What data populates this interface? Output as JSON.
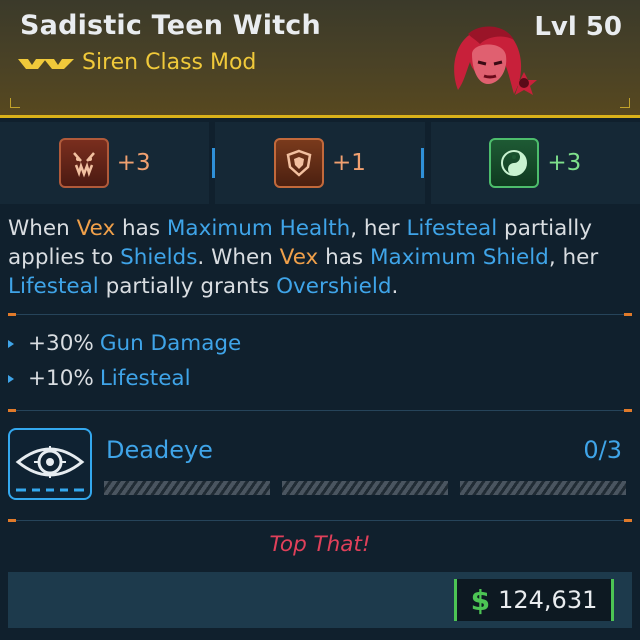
{
  "item": {
    "name": "Sadistic Teen Witch",
    "class_label": "Siren Class Mod",
    "level": "Lvl 50",
    "rarity_color": "#d9b21a"
  },
  "bonuses": [
    {
      "icon": "fangs-icon",
      "value": "+3",
      "color": "#f0a070"
    },
    {
      "icon": "shield-emblem-icon",
      "value": "+1",
      "color": "#f0a070"
    },
    {
      "icon": "yin-yang-gun-icon",
      "value": "+3",
      "color": "#7ee08b"
    }
  ],
  "description": {
    "p1": "When ",
    "vex1": "Vex",
    "p2": " has ",
    "max_health": "Maximum Health",
    "p3": ", her ",
    "lifesteal1": "Lifesteal",
    "p4": " partially applies to ",
    "shields": "Shields",
    "p5": ". When ",
    "vex2": "Vex",
    "p6": " has ",
    "max_shield": "Maximum Shield",
    "p7": ", her ",
    "lifesteal2": "Lifesteal",
    "p8": " partially grants ",
    "overshield": "Overshield",
    "p9": "."
  },
  "stats": [
    {
      "value": "+30%",
      "name": "Gun Damage"
    },
    {
      "value": "+10%",
      "name": "Lifesteal"
    }
  ],
  "skill": {
    "name": "Deadeye",
    "rank": "0/3",
    "icon": "eye-target-icon"
  },
  "flavor_text": "Top That!",
  "price": {
    "symbol": "$",
    "value": "124,631"
  }
}
